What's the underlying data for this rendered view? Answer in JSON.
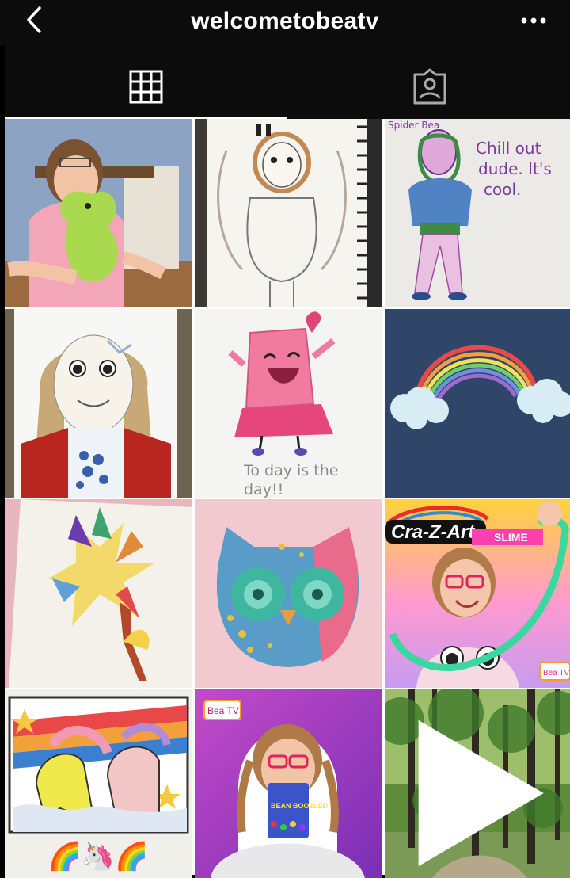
{
  "header": {
    "username": "welcometobeatv",
    "back_icon": "chevron-left-icon",
    "more_icon": "more-horizontal-icon"
  },
  "tabs": [
    {
      "name": "posts-grid",
      "icon": "grid-icon",
      "selected": true
    },
    {
      "name": "tagged",
      "icon": "tagged-person-icon",
      "selected": false
    }
  ],
  "posts": {
    "p3": {
      "heading": "Spider Bea",
      "caption": [
        "Chill out",
        "dude. It's",
        "cool."
      ]
    },
    "p5": {
      "caption": [
        "To day is the",
        "day!!"
      ]
    },
    "p9": {
      "brand": "Cra-Z-Art",
      "product": "SLIME",
      "badge": "Bea TV"
    },
    "p10": {
      "emoji": "🌈🦄🌈"
    },
    "p11": {
      "badge": "Bea TV",
      "package_text": "BEAN BOOZLED"
    },
    "p12": {
      "type": "video",
      "indicator_icon": "play-icon"
    }
  },
  "colors": {
    "header_bg": "#0c0c0c",
    "grid_gap": "#ffffff",
    "icon": "#ffffff"
  }
}
